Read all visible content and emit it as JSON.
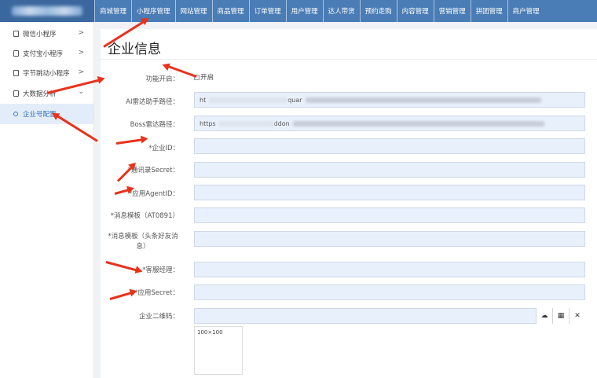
{
  "top_nav": {
    "items": [
      "商城管理",
      "小程序管理",
      "网站管理",
      "商品管理",
      "订单管理",
      "用户管理",
      "达人带货",
      "预约走购",
      "内容管理",
      "营销管理",
      "拼团管理",
      "商户管理"
    ]
  },
  "sidebar": {
    "items": [
      {
        "label": "微信小程序",
        "icon": "mini-program-icon"
      },
      {
        "label": "支付宝小程序",
        "icon": "mini-program-icon"
      },
      {
        "label": "字节跳动小程序",
        "icon": "mini-program-icon"
      },
      {
        "label": "大数据分析",
        "icon": "mini-program-icon"
      },
      {
        "label": "企业号配置",
        "icon": "circle-icon"
      }
    ]
  },
  "form": {
    "title": "企业信息",
    "enable_label": "功能开启：",
    "enable_checkbox_label": "开启",
    "ai_path_label": "AI雷达助手路径：",
    "ai_path_value_start": "ht",
    "ai_path_value_mid": "quar",
    "boss_path_label": "Boss雷达路径：",
    "boss_path_value_start": "https",
    "boss_path_value_mid": "ddon",
    "corp_id_label": "*企业ID：",
    "contacts_secret_label": "*通讯录Secret：",
    "agent_id_label": "*应用AgentID：",
    "msg_template_label": "*消息模板（AT0891）",
    "msg_template_friend_label": "*消息模板（头条好友消息）",
    "manager_label": "*客服经理：",
    "app_secret_label": "*应用Secret：",
    "qrcode_label": "企业二维码：",
    "qrcode_placeholder": "100×100"
  },
  "colors": {
    "nav_bg": "#4a7cb5",
    "active_bg": "#e3edf9",
    "active_text": "#3a75c4",
    "input_bg": "#e8f0fc",
    "annotation_arrow": "#e8321c"
  }
}
